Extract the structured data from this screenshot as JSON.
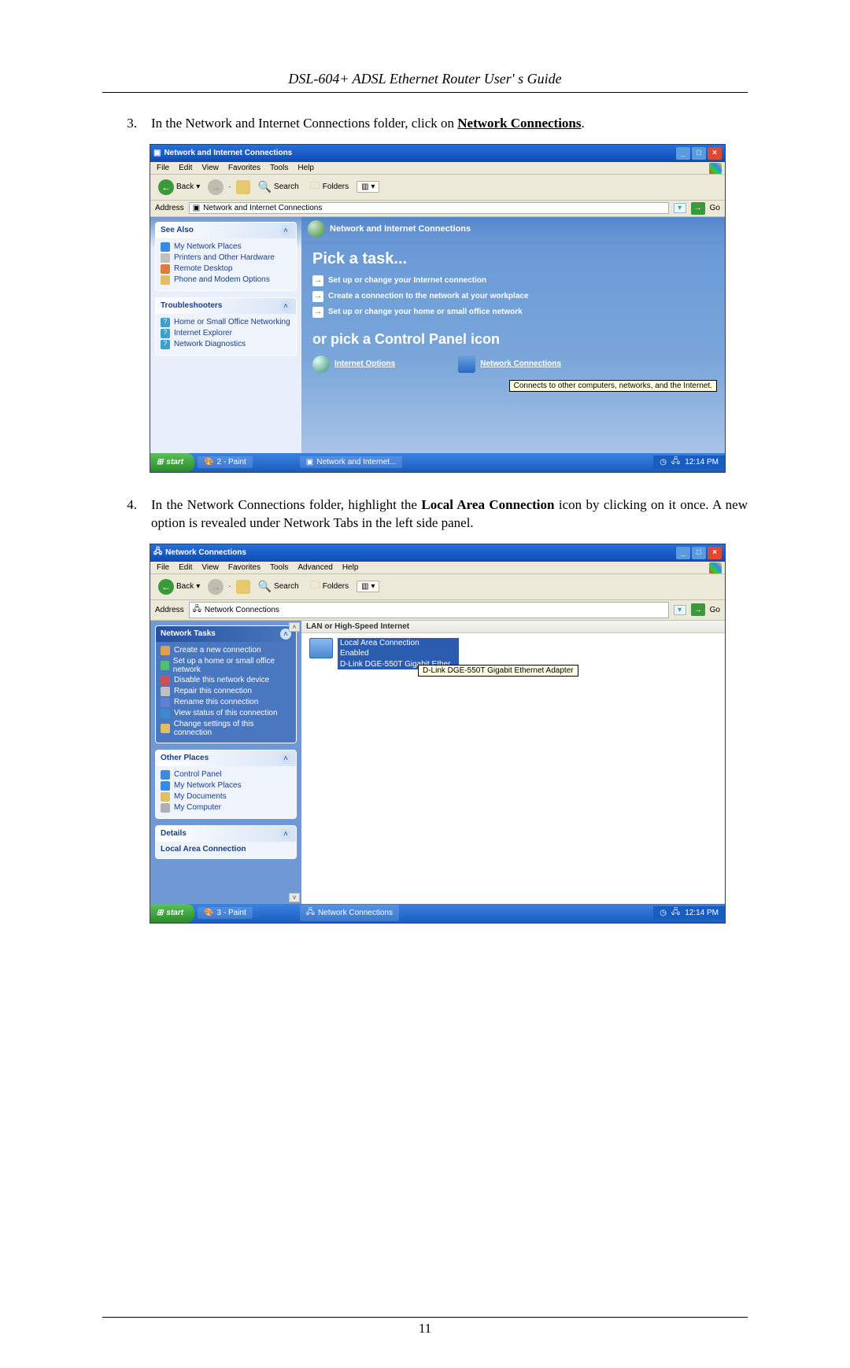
{
  "doc_header": "DSL-604+ ADSL Ethernet Router User' s Guide",
  "page_number": "11",
  "steps": {
    "s3": {
      "num": "3.",
      "pre": "In the Network and Internet Connections folder, click on ",
      "link": "Network Connections",
      "post": "."
    },
    "s4": {
      "num": "4.",
      "text": "In the Network Connections folder, highlight the ",
      "bold": "Local Area Connection",
      "text2": " icon by clicking on it once. A new option is revealed under Network Tabs in the left side panel."
    }
  },
  "shot1": {
    "title": "Network and Internet Connections",
    "menus": [
      "File",
      "Edit",
      "View",
      "Favorites",
      "Tools",
      "Help"
    ],
    "back": "Back",
    "search": "Search",
    "folders": "Folders",
    "addr_label": "Address",
    "addr_value": "Network and Internet Connections",
    "go": "Go",
    "see_also": {
      "title": "See Also",
      "items": [
        "My Network Places",
        "Printers and Other Hardware",
        "Remote Desktop",
        "Phone and Modem Options"
      ]
    },
    "troubleshooters": {
      "title": "Troubleshooters",
      "items": [
        "Home or Small Office Networking",
        "Internet Explorer",
        "Network Diagnostics"
      ]
    },
    "main": {
      "band": "Network and Internet Connections",
      "pick": "Pick a task...",
      "tasks": [
        "Set up or change your Internet connection",
        "Create a connection to the network at your workplace",
        "Set up or change your home or small office network"
      ],
      "orpick": "or pick a Control Panel icon",
      "cp1": "Internet Options",
      "cp2": "Network Connections",
      "tooltip": "Connects to other computers, networks, and the Internet."
    },
    "taskbar": {
      "start": "start",
      "task1": "2 - Paint",
      "task2": "Network and Internet...",
      "time": "12:14 PM"
    }
  },
  "shot2": {
    "title": "Network Connections",
    "menus": [
      "File",
      "Edit",
      "View",
      "Favorites",
      "Tools",
      "Advanced",
      "Help"
    ],
    "back": "Back",
    "search": "Search",
    "folders": "Folders",
    "addr_label": "Address",
    "addr_value": "Network Connections",
    "go": "Go",
    "net_tasks": {
      "title": "Network Tasks",
      "items": [
        "Create a new connection",
        "Set up a home or small office network",
        "Disable this network device",
        "Repair this connection",
        "Rename this connection",
        "View status of this connection",
        "Change settings of this connection"
      ]
    },
    "other_places": {
      "title": "Other Places",
      "items": [
        "Control Panel",
        "My Network Places",
        "My Documents",
        "My Computer"
      ]
    },
    "details": {
      "title": "Details",
      "sub": "Local Area Connection"
    },
    "main": {
      "group": "LAN or High-Speed Internet",
      "item_name": "Local Area Connection",
      "item_status": "Enabled",
      "item_dev": "D-Link DGE-550T Gigabit Ether...",
      "tooltip": "D-Link DGE-550T Gigabit Ethernet Adapter"
    },
    "taskbar": {
      "start": "start",
      "task1": "3 - Paint",
      "task2": "Network Connections",
      "time": "12:14 PM"
    }
  }
}
